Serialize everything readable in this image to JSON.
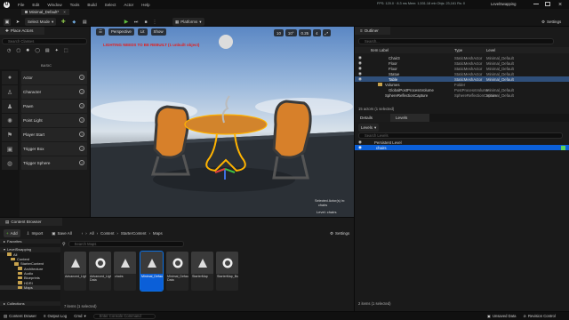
{
  "titlebar": {
    "project": "LevelSwapping",
    "tab": "Minimal_Default*",
    "stats": "FPS: 120.0 · 8.3 ms  Mem: 1,531.18 mb  Objs: 23,161  Rs: 0"
  },
  "menu": [
    "File",
    "Edit",
    "Window",
    "Tools",
    "Build",
    "Select",
    "Actor",
    "Help"
  ],
  "toolbar": {
    "select_mode": "Select Mode",
    "platforms": "Platforms",
    "settings": "Settings"
  },
  "place_actors": {
    "title": "Place Actors",
    "search_placeholder": "Search Classes",
    "category": "BASIC",
    "items": [
      "Actor",
      "Character",
      "Pawn",
      "Point Light",
      "Player Start",
      "Trigger Box",
      "Trigger Sphere"
    ]
  },
  "viewport": {
    "perspective": "Perspective",
    "lit": "Lit",
    "show": "Show",
    "warning": "LIGHTING NEEDS TO BE REBUILT (1 unbuilt object)",
    "grid": "10",
    "angle": "10°",
    "scale": "0.25",
    "cam": "4",
    "selected": "Selected Actor(s) in:",
    "selected_level": "chairs",
    "level_label": "Level: chairs"
  },
  "outliner": {
    "title": "Outliner",
    "search_placeholder": "Search...",
    "col_item": "Item Label",
    "col_type": "Type",
    "col_level": "Level",
    "rows": [
      {
        "label": "Chair3",
        "type": "StaticMeshActor",
        "level": "Minimal_Default"
      },
      {
        "label": "Floor",
        "type": "StaticMeshActor",
        "level": "Minimal_Default"
      },
      {
        "label": "Floor",
        "type": "StaticMeshActor",
        "level": "Minimal_Default"
      },
      {
        "label": "Statue",
        "type": "StaticMeshActor",
        "level": "Minimal_Default"
      },
      {
        "label": "Table",
        "type": "StaticMeshActor",
        "level": "Minimal_Default"
      },
      {
        "label": "Volumes",
        "type": "Folder",
        "level": ""
      },
      {
        "label": "GlobalPostProcessVolume",
        "type": "PostProcessVolume",
        "level": "Minimal_Default"
      },
      {
        "label": "SphereReflectionCapture",
        "type": "SphereReflectionCapture",
        "level": "Minimal_Default"
      }
    ],
    "footer": "15 actors (1 selected)"
  },
  "details_tab": "Details",
  "levels": {
    "tab": "Levels",
    "dropdown": "Levels",
    "search_placeholder": "Search Levels",
    "rows": [
      "Persistent Level",
      "chairs"
    ],
    "footer": "2 items (1 selected)"
  },
  "content_browser": {
    "title": "Content Browser",
    "add": "Add",
    "import": "Import",
    "save_all": "Save All",
    "path": [
      "All",
      "Content",
      "StarterContent",
      "Maps"
    ],
    "settings": "Settings",
    "favorites": "Favorites",
    "project": "LevelSwapping",
    "tree": [
      "All",
      "Content",
      "StarterContent",
      "Architecture",
      "Audio",
      "Blueprints",
      "HDRI",
      "Maps"
    ],
    "search_placeholder": "Search Maps",
    "assets": [
      "Advanced_Lighting",
      "Advanced_Lighting_Built Data",
      "chairs",
      "Minimal_Default",
      "Minimal_Default_Built Data",
      "StarterMap",
      "StarterMap_BuiltData"
    ],
    "footer": "7 items (1 selected)",
    "collections": "Collections"
  },
  "statusbar": {
    "content_drawer": "Content Drawer",
    "output_log": "Output Log",
    "cmd": "Cmd",
    "console_placeholder": "Enter Console Command",
    "unsaved": "Unsaved Data",
    "revision": "Revision Control"
  }
}
